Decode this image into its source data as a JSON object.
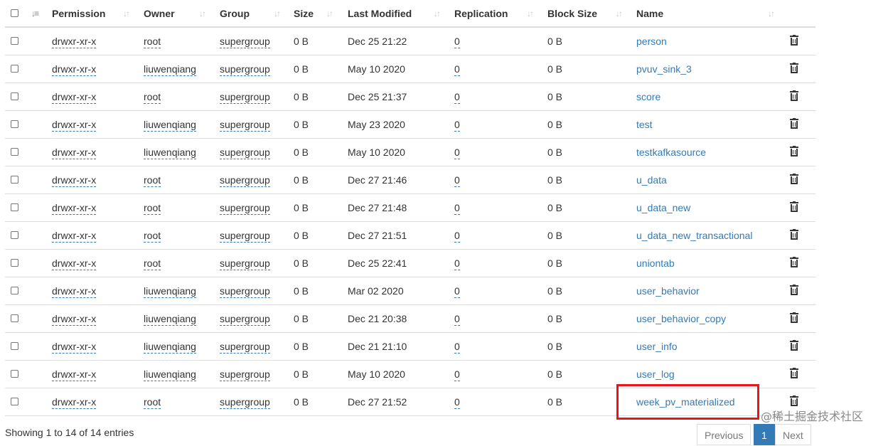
{
  "table": {
    "columns": [
      "Permission",
      "Owner",
      "Group",
      "Size",
      "Last Modified",
      "Replication",
      "Block Size",
      "Name"
    ],
    "rows": [
      {
        "permission": "drwxr-xr-x",
        "owner": "root",
        "group": "supergroup",
        "size": "0 B",
        "modified": "Dec 25 21:22",
        "replication": "0",
        "block_size": "0 B",
        "name": "person"
      },
      {
        "permission": "drwxr-xr-x",
        "owner": "liuwenqiang",
        "group": "supergroup",
        "size": "0 B",
        "modified": "May 10 2020",
        "replication": "0",
        "block_size": "0 B",
        "name": "pvuv_sink_3"
      },
      {
        "permission": "drwxr-xr-x",
        "owner": "root",
        "group": "supergroup",
        "size": "0 B",
        "modified": "Dec 25 21:37",
        "replication": "0",
        "block_size": "0 B",
        "name": "score"
      },
      {
        "permission": "drwxr-xr-x",
        "owner": "liuwenqiang",
        "group": "supergroup",
        "size": "0 B",
        "modified": "May 23 2020",
        "replication": "0",
        "block_size": "0 B",
        "name": "test"
      },
      {
        "permission": "drwxr-xr-x",
        "owner": "liuwenqiang",
        "group": "supergroup",
        "size": "0 B",
        "modified": "May 10 2020",
        "replication": "0",
        "block_size": "0 B",
        "name": "testkafkasource"
      },
      {
        "permission": "drwxr-xr-x",
        "owner": "root",
        "group": "supergroup",
        "size": "0 B",
        "modified": "Dec 27 21:46",
        "replication": "0",
        "block_size": "0 B",
        "name": "u_data"
      },
      {
        "permission": "drwxr-xr-x",
        "owner": "root",
        "group": "supergroup",
        "size": "0 B",
        "modified": "Dec 27 21:48",
        "replication": "0",
        "block_size": "0 B",
        "name": "u_data_new"
      },
      {
        "permission": "drwxr-xr-x",
        "owner": "root",
        "group": "supergroup",
        "size": "0 B",
        "modified": "Dec 27 21:51",
        "replication": "0",
        "block_size": "0 B",
        "name": "u_data_new_transactional"
      },
      {
        "permission": "drwxr-xr-x",
        "owner": "root",
        "group": "supergroup",
        "size": "0 B",
        "modified": "Dec 25 22:41",
        "replication": "0",
        "block_size": "0 B",
        "name": "uniontab"
      },
      {
        "permission": "drwxr-xr-x",
        "owner": "liuwenqiang",
        "group": "supergroup",
        "size": "0 B",
        "modified": "Mar 02 2020",
        "replication": "0",
        "block_size": "0 B",
        "name": "user_behavior"
      },
      {
        "permission": "drwxr-xr-x",
        "owner": "liuwenqiang",
        "group": "supergroup",
        "size": "0 B",
        "modified": "Dec 21 20:38",
        "replication": "0",
        "block_size": "0 B",
        "name": "user_behavior_copy"
      },
      {
        "permission": "drwxr-xr-x",
        "owner": "liuwenqiang",
        "group": "supergroup",
        "size": "0 B",
        "modified": "Dec 21 21:10",
        "replication": "0",
        "block_size": "0 B",
        "name": "user_info"
      },
      {
        "permission": "drwxr-xr-x",
        "owner": "liuwenqiang",
        "group": "supergroup",
        "size": "0 B",
        "modified": "May 10 2020",
        "replication": "0",
        "block_size": "0 B",
        "name": "user_log"
      },
      {
        "permission": "drwxr-xr-x",
        "owner": "root",
        "group": "supergroup",
        "size": "0 B",
        "modified": "Dec 27 21:52",
        "replication": "0",
        "block_size": "0 B",
        "name": "week_pv_materialized"
      }
    ]
  },
  "footer": {
    "info": "Showing 1 to 14 of 14 entries",
    "previous": "Previous",
    "current_page": "1",
    "next": "Next"
  },
  "watermark": "@稀土掘金技术社区",
  "colors": {
    "link": "#337ab7",
    "highlight": "#e8161a",
    "border": "#dddddd"
  },
  "icons": {
    "row_action": "trash-icon",
    "sort": "sort-icon"
  }
}
